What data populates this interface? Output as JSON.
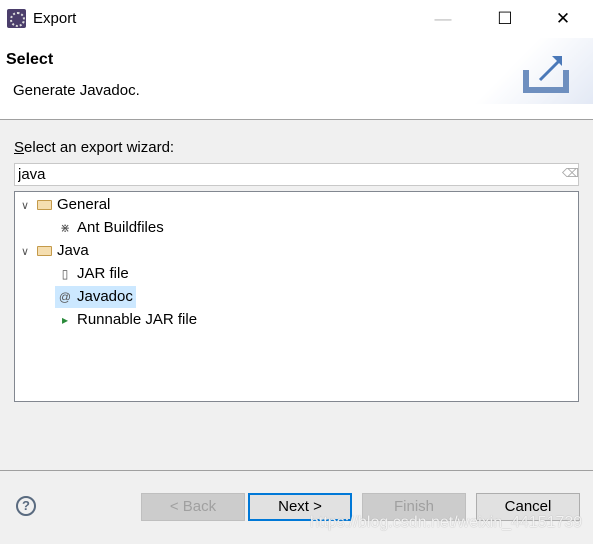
{
  "window": {
    "title": "Export",
    "minimize": "—",
    "maximize": "☐",
    "close": "✕"
  },
  "header": {
    "title": "Select",
    "description": "Generate Javadoc."
  },
  "wizard": {
    "label": "Select an export wizard:",
    "label_mnemonic": "S",
    "label_rest": "elect an export wizard:",
    "filter_value": "java"
  },
  "tree": [
    {
      "label": "General",
      "type": "folder",
      "expanded": true,
      "children": [
        {
          "label": "Ant Buildfiles",
          "icon": "ant-icon"
        }
      ]
    },
    {
      "label": "Java",
      "type": "folder",
      "expanded": true,
      "children": [
        {
          "label": "JAR file",
          "icon": "jar-icon"
        },
        {
          "label": "Javadoc",
          "icon": "javadoc-icon",
          "selected": true
        },
        {
          "label": "Runnable JAR file",
          "icon": "runnable-jar-icon"
        }
      ]
    }
  ],
  "buttons": {
    "back": "< Back",
    "next": "Next >",
    "finish": "Finish",
    "cancel": "Cancel"
  },
  "watermark": "https://blog.csdn.net/weixin_44151739"
}
